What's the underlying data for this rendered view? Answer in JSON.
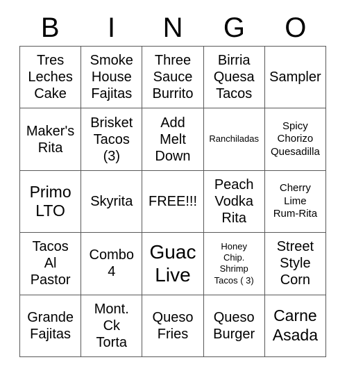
{
  "card": {
    "title": "BINGO",
    "free_space_label": "FREE!!!",
    "border_color": "#595959",
    "text_color": "#000000",
    "background_color": "#ffffff"
  },
  "header": {
    "letters": [
      {
        "label": "B"
      },
      {
        "label": "I"
      },
      {
        "label": "N"
      },
      {
        "label": "G"
      },
      {
        "label": "O"
      }
    ]
  },
  "grid": {
    "columns": 5,
    "rows": 5,
    "cells": [
      {
        "id": "b1",
        "column": "B",
        "row": 1,
        "text": "Tres\nLeches\nCake",
        "size": "md"
      },
      {
        "id": "i1",
        "column": "I",
        "row": 1,
        "text": "Smoke\nHouse\nFajitas",
        "size": "md"
      },
      {
        "id": "n1",
        "column": "N",
        "row": 1,
        "text": "Three\nSauce\nBurrito",
        "size": "md"
      },
      {
        "id": "g1",
        "column": "G",
        "row": 1,
        "text": "Birria\nQuesa\nTacos",
        "size": "md"
      },
      {
        "id": "o1",
        "column": "O",
        "row": 1,
        "text": "Sampler",
        "size": "md"
      },
      {
        "id": "b2",
        "column": "B",
        "row": 2,
        "text": "Maker's\nRita",
        "size": "md"
      },
      {
        "id": "i2",
        "column": "I",
        "row": 2,
        "text": "Brisket\nTacos\n(3)",
        "size": "md"
      },
      {
        "id": "n2",
        "column": "N",
        "row": 2,
        "text": "Add\nMelt\nDown",
        "size": "md"
      },
      {
        "id": "g2",
        "column": "G",
        "row": 2,
        "text": "Ranchiladas",
        "size": "xs"
      },
      {
        "id": "o2",
        "column": "O",
        "row": 2,
        "text": "Spicy\nChorizo\nQuesadilla",
        "size": "sm"
      },
      {
        "id": "b3",
        "column": "B",
        "row": 3,
        "text": "Primo\nLTO",
        "size": "lg"
      },
      {
        "id": "i3",
        "column": "I",
        "row": 3,
        "text": "Skyrita",
        "size": "md"
      },
      {
        "id": "n3",
        "column": "N",
        "row": 3,
        "text": "FREE!!!",
        "size": "md"
      },
      {
        "id": "g3",
        "column": "G",
        "row": 3,
        "text": "Peach\nVodka\nRita",
        "size": "md"
      },
      {
        "id": "o3",
        "column": "O",
        "row": 3,
        "text": "Cherry\nLime\nRum-Rita",
        "size": "sm"
      },
      {
        "id": "b4",
        "column": "B",
        "row": 4,
        "text": "Tacos\nAl\nPastor",
        "size": "md"
      },
      {
        "id": "i4",
        "column": "I",
        "row": 4,
        "text": "Combo\n4",
        "size": "md"
      },
      {
        "id": "n4",
        "column": "N",
        "row": 4,
        "text": "Guac\nLive",
        "size": "xl"
      },
      {
        "id": "g4",
        "column": "G",
        "row": 4,
        "text": "Honey\nChip.\nShrimp\nTacos ( 3)",
        "size": "xs"
      },
      {
        "id": "o4",
        "column": "O",
        "row": 4,
        "text": "Street\nStyle\nCorn",
        "size": "md"
      },
      {
        "id": "b5",
        "column": "B",
        "row": 5,
        "text": "Grande\nFajitas",
        "size": "md"
      },
      {
        "id": "i5",
        "column": "I",
        "row": 5,
        "text": "Mont.\nCk\nTorta",
        "size": "md"
      },
      {
        "id": "n5",
        "column": "N",
        "row": 5,
        "text": "Queso\nFries",
        "size": "md"
      },
      {
        "id": "g5",
        "column": "G",
        "row": 5,
        "text": "Queso\nBurger",
        "size": "md"
      },
      {
        "id": "o5",
        "column": "O",
        "row": 5,
        "text": "Carne\nAsada",
        "size": "lg"
      }
    ]
  }
}
